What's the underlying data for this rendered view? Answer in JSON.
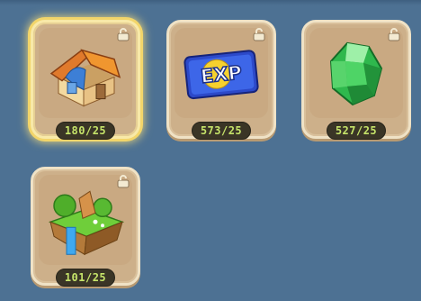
{
  "inventory": {
    "items": [
      {
        "name": "house",
        "count": "180/25",
        "icon": "house-icon",
        "selected": true
      },
      {
        "name": "exp-card",
        "count": "573/25",
        "icon": "exp-card-icon",
        "label": "EXP"
      },
      {
        "name": "green-gem",
        "count": "527/25",
        "icon": "green-gem-icon"
      },
      {
        "name": "floating-island",
        "count": "101/25",
        "icon": "floating-island-icon"
      }
    ]
  },
  "colors": {
    "background": "#4d7193",
    "slot": "#cdb08a",
    "count_text": "#c6e46a",
    "selected_glow": "#f2d56a"
  }
}
